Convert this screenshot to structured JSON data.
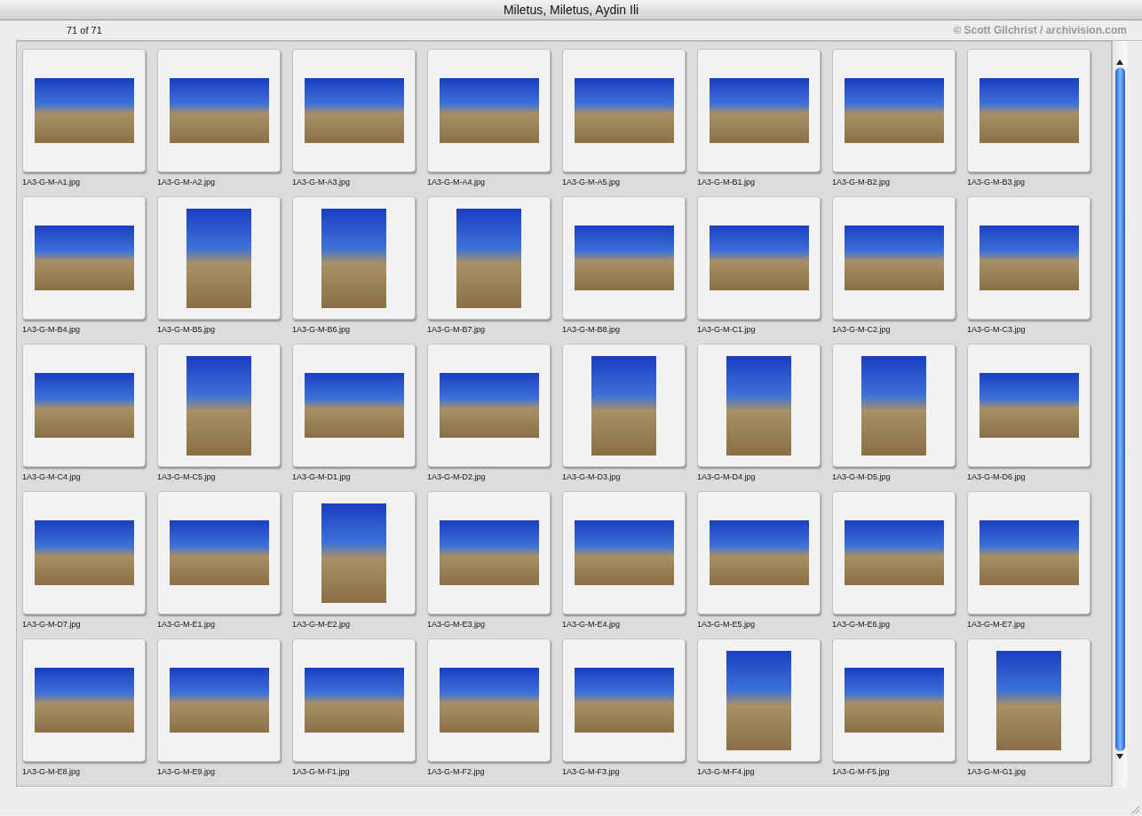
{
  "window": {
    "title": "Miletus, Miletus, Aydin Ili"
  },
  "toolbar": {
    "count": "71 of 71",
    "credit": "© Scott Gilchrist / archivision.com"
  },
  "thumbnails": [
    {
      "label": "1A3-G-M-A1.jpg",
      "kind": "landscape"
    },
    {
      "label": "1A3-G-M-A2.jpg",
      "kind": "landscape"
    },
    {
      "label": "1A3-G-M-A3.jpg",
      "kind": "landscape"
    },
    {
      "label": "1A3-G-M-A4.jpg",
      "kind": "landscape"
    },
    {
      "label": "1A3-G-M-A5.jpg",
      "kind": "landscape"
    },
    {
      "label": "1A3-G-M-B1.jpg",
      "kind": "landscape"
    },
    {
      "label": "1A3-G-M-B2.jpg",
      "kind": "landscape"
    },
    {
      "label": "1A3-G-M-B3.jpg",
      "kind": "landscape"
    },
    {
      "label": "1A3-G-M-B4.jpg",
      "kind": "landscape"
    },
    {
      "label": "1A3-G-M-B5.jpg",
      "kind": "portrait"
    },
    {
      "label": "1A3-G-M-B6.jpg",
      "kind": "portrait"
    },
    {
      "label": "1A3-G-M-B7.jpg",
      "kind": "portrait"
    },
    {
      "label": "1A3-G-M-B8.jpg",
      "kind": "landscape"
    },
    {
      "label": "1A3-G-M-C1.jpg",
      "kind": "landscape"
    },
    {
      "label": "1A3-G-M-C2.jpg",
      "kind": "landscape"
    },
    {
      "label": "1A3-G-M-C3.jpg",
      "kind": "landscape"
    },
    {
      "label": "1A3-G-M-C4.jpg",
      "kind": "landscape"
    },
    {
      "label": "1A3-G-M-C5.jpg",
      "kind": "portrait"
    },
    {
      "label": "1A3-G-M-D1.jpg",
      "kind": "landscape"
    },
    {
      "label": "1A3-G-M-D2.jpg",
      "kind": "landscape"
    },
    {
      "label": "1A3-G-M-D3.jpg",
      "kind": "portrait"
    },
    {
      "label": "1A3-G-M-D4.jpg",
      "kind": "portrait"
    },
    {
      "label": "1A3-G-M-D5.jpg",
      "kind": "portrait"
    },
    {
      "label": "1A3-G-M-D6.jpg",
      "kind": "landscape"
    },
    {
      "label": "1A3-G-M-D7.jpg",
      "kind": "landscape"
    },
    {
      "label": "1A3-G-M-E1.jpg",
      "kind": "landscape"
    },
    {
      "label": "1A3-G-M-E2.jpg",
      "kind": "portrait"
    },
    {
      "label": "1A3-G-M-E3.jpg",
      "kind": "landscape"
    },
    {
      "label": "1A3-G-M-E4.jpg",
      "kind": "landscape"
    },
    {
      "label": "1A3-G-M-E5.jpg",
      "kind": "landscape"
    },
    {
      "label": "1A3-G-M-E6.jpg",
      "kind": "landscape"
    },
    {
      "label": "1A3-G-M-E7.jpg",
      "kind": "landscape"
    },
    {
      "label": "1A3-G-M-E8.jpg",
      "kind": "landscape"
    },
    {
      "label": "1A3-G-M-E9.jpg",
      "kind": "landscape"
    },
    {
      "label": "1A3-G-M-F1.jpg",
      "kind": "landscape"
    },
    {
      "label": "1A3-G-M-F2.jpg",
      "kind": "landscape"
    },
    {
      "label": "1A3-G-M-F3.jpg",
      "kind": "landscape"
    },
    {
      "label": "1A3-G-M-F4.jpg",
      "kind": "portrait"
    },
    {
      "label": "1A3-G-M-F5.jpg",
      "kind": "landscape"
    },
    {
      "label": "1A3-G-M-G1.jpg",
      "kind": "portrait"
    }
  ]
}
